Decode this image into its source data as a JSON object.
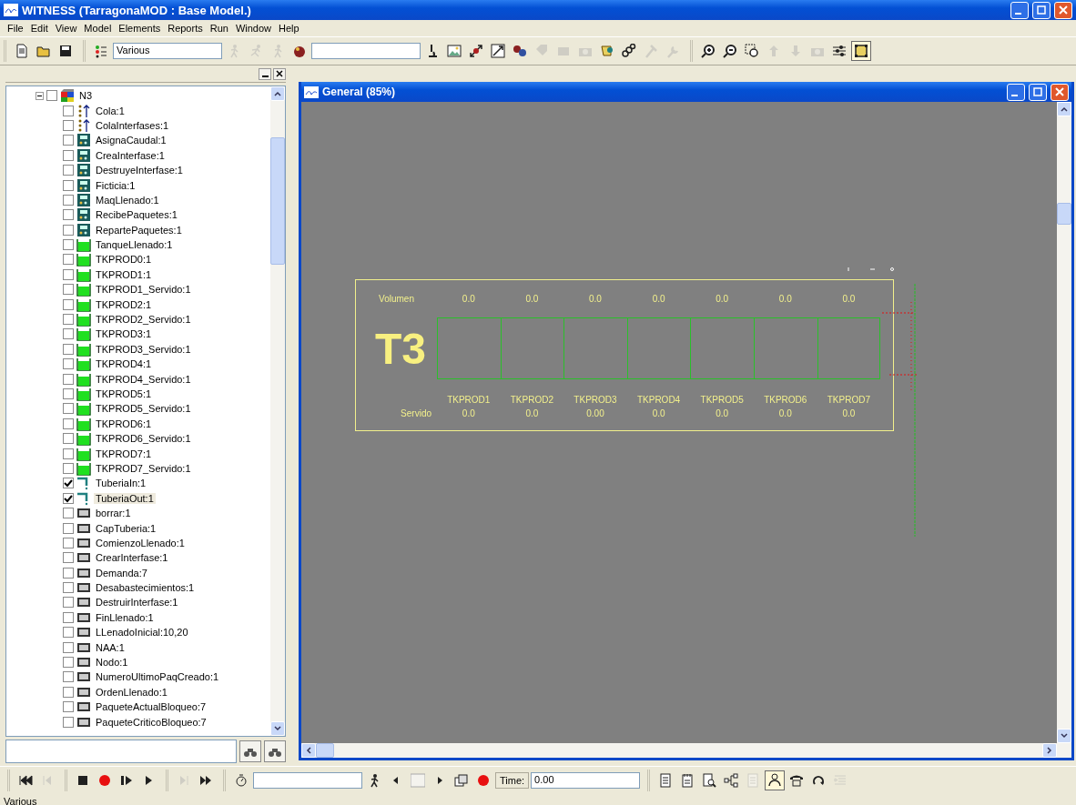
{
  "window": {
    "title": "WITNESS (TarragonaMOD : Base Model.)"
  },
  "menu": [
    "File",
    "Edit",
    "View",
    "Model",
    "Elements",
    "Reports",
    "Run",
    "Window",
    "Help"
  ],
  "toolbar_groups": [
    [
      {
        "kind": "new",
        "disabled": false,
        "pressed": false
      },
      {
        "kind": "open",
        "disabled": false,
        "pressed": false
      },
      {
        "kind": "save",
        "disabled": false,
        "pressed": false
      }
    ],
    [
      {
        "kind": "list",
        "disabled": false,
        "pressed": false
      },
      {
        "kind": "field",
        "value": "Various"
      },
      {
        "kind": "walker",
        "disabled": true,
        "pressed": false
      },
      {
        "kind": "runner",
        "disabled": true,
        "pressed": false
      },
      {
        "kind": "walker",
        "disabled": true,
        "pressed": false
      },
      {
        "kind": "ball",
        "disabled": false,
        "pressed": false
      },
      {
        "kind": "field"
      },
      {
        "kind": "microscope",
        "disabled": false,
        "pressed": false
      },
      {
        "kind": "picture",
        "disabled": false,
        "pressed": false
      },
      {
        "kind": "arrows",
        "disabled": false,
        "pressed": false
      },
      {
        "kind": "resize",
        "disabled": false,
        "pressed": false
      },
      {
        "kind": "balls",
        "disabled": false,
        "pressed": false
      },
      {
        "kind": "tag",
        "disabled": true,
        "pressed": false
      },
      {
        "kind": "box",
        "disabled": true,
        "pressed": false
      },
      {
        "kind": "camera",
        "disabled": true,
        "pressed": false
      },
      {
        "kind": "scroll",
        "disabled": false,
        "pressed": false
      },
      {
        "kind": "links",
        "disabled": false,
        "pressed": false
      },
      {
        "kind": "hammer",
        "disabled": true,
        "pressed": false
      },
      {
        "kind": "wrench",
        "disabled": true,
        "pressed": false
      }
    ],
    [
      {
        "kind": "zoomin",
        "disabled": false,
        "pressed": false
      },
      {
        "kind": "zoomout",
        "disabled": false,
        "pressed": false
      },
      {
        "kind": "zoomfit",
        "disabled": false,
        "pressed": false
      },
      {
        "kind": "up",
        "disabled": true,
        "pressed": false
      },
      {
        "kind": "down",
        "disabled": true,
        "pressed": false
      },
      {
        "kind": "camera",
        "disabled": true,
        "pressed": false
      },
      {
        "kind": "sliders",
        "disabled": false,
        "pressed": false
      },
      {
        "kind": "frame",
        "disabled": false,
        "pressed": true
      }
    ]
  ],
  "tree": {
    "label": "N3",
    "kind": "module",
    "checked": false,
    "expanded": true,
    "children": [
      {
        "label": "Cola:1",
        "kind": "queue",
        "checked": false
      },
      {
        "label": "ColaInterfases:1",
        "kind": "queue",
        "checked": false
      },
      {
        "label": "AsignaCaudal:1",
        "kind": "machine",
        "checked": false
      },
      {
        "label": "CreaInterfase:1",
        "kind": "machine",
        "checked": false
      },
      {
        "label": "DestruyeInterfase:1",
        "kind": "machine",
        "checked": false
      },
      {
        "label": "Ficticia:1",
        "kind": "machine",
        "checked": false
      },
      {
        "label": "MaqLlenado:1",
        "kind": "machine",
        "checked": false
      },
      {
        "label": "RecibePaquetes:1",
        "kind": "machine",
        "checked": false
      },
      {
        "label": "RepartePaquetes:1",
        "kind": "machine",
        "checked": false
      },
      {
        "label": "TanqueLlenado:1",
        "kind": "tank",
        "checked": false
      },
      {
        "label": "TKPROD0:1",
        "kind": "tank",
        "checked": false
      },
      {
        "label": "TKPROD1:1",
        "kind": "tank",
        "checked": false
      },
      {
        "label": "TKPROD1_Servido:1",
        "kind": "tank",
        "checked": false
      },
      {
        "label": "TKPROD2:1",
        "kind": "tank",
        "checked": false
      },
      {
        "label": "TKPROD2_Servido:1",
        "kind": "tank",
        "checked": false
      },
      {
        "label": "TKPROD3:1",
        "kind": "tank",
        "checked": false
      },
      {
        "label": "TKPROD3_Servido:1",
        "kind": "tank",
        "checked": false
      },
      {
        "label": "TKPROD4:1",
        "kind": "tank",
        "checked": false
      },
      {
        "label": "TKPROD4_Servido:1",
        "kind": "tank",
        "checked": false
      },
      {
        "label": "TKPROD5:1",
        "kind": "tank",
        "checked": false
      },
      {
        "label": "TKPROD5_Servido:1",
        "kind": "tank",
        "checked": false
      },
      {
        "label": "TKPROD6:1",
        "kind": "tank",
        "checked": false
      },
      {
        "label": "TKPROD6_Servido:1",
        "kind": "tank",
        "checked": false
      },
      {
        "label": "TKPROD7:1",
        "kind": "tank",
        "checked": false
      },
      {
        "label": "TKPROD7_Servido:1",
        "kind": "tank",
        "checked": false
      },
      {
        "label": "TuberiaIn:1",
        "kind": "pipe",
        "checked": true
      },
      {
        "label": "TuberiaOut:1",
        "kind": "pipe",
        "checked": true,
        "selected": true
      },
      {
        "label": "borrar:1",
        "kind": "variable",
        "checked": false
      },
      {
        "label": "CapTuberia:1",
        "kind": "variable",
        "checked": false
      },
      {
        "label": "ComienzoLlenado:1",
        "kind": "variable",
        "checked": false
      },
      {
        "label": "CrearInterfase:1",
        "kind": "variable",
        "checked": false
      },
      {
        "label": "Demanda:7",
        "kind": "variable",
        "checked": false
      },
      {
        "label": "Desabastecimientos:1",
        "kind": "variable",
        "checked": false
      },
      {
        "label": "DestruirInterfase:1",
        "kind": "variable",
        "checked": false
      },
      {
        "label": "FinLlenado:1",
        "kind": "variable",
        "checked": false
      },
      {
        "label": "LLenadoInicial:10,20",
        "kind": "variable",
        "checked": false
      },
      {
        "label": "NAA:1",
        "kind": "variable",
        "checked": false
      },
      {
        "label": "Nodo:1",
        "kind": "variable",
        "checked": false
      },
      {
        "label": "NumeroUltimoPaqCreado:1",
        "kind": "variable",
        "checked": false
      },
      {
        "label": "OrdenLlenado:1",
        "kind": "variable",
        "checked": false
      },
      {
        "label": "PaqueteActualBloqueo:7",
        "kind": "variable",
        "checked": false
      },
      {
        "label": "PaqueteCriticoBloqueo:7",
        "kind": "variable",
        "checked": false
      }
    ]
  },
  "child_window": {
    "title": "General (85%)"
  },
  "diagram": {
    "title": "T3",
    "volume_label": "Volumen",
    "served_label": "Servido",
    "tanks": [
      {
        "name": "TKPROD1",
        "volume": "0.0",
        "served": "0.0"
      },
      {
        "name": "TKPROD2",
        "volume": "0.0",
        "served": "0.0"
      },
      {
        "name": "TKPROD3",
        "volume": "0.0",
        "served": "0.00"
      },
      {
        "name": "TKPROD4",
        "volume": "0.0",
        "served": "0.0"
      },
      {
        "name": "TKPROD5",
        "volume": "0.0",
        "served": "0.0"
      },
      {
        "name": "TKPROD6",
        "volume": "0.0",
        "served": "0.0"
      },
      {
        "name": "TKPROD7",
        "volume": "0.0",
        "served": "0.0"
      }
    ]
  },
  "bottom_toolbar_groups": [
    [
      {
        "kind": "rewind",
        "disabled": false,
        "pressed": false
      },
      {
        "kind": "stepback",
        "disabled": true,
        "pressed": false
      }
    ],
    [
      {
        "kind": "stop",
        "disabled": false,
        "pressed": false
      },
      {
        "kind": "record",
        "disabled": false,
        "pressed": false
      },
      {
        "kind": "step",
        "disabled": false,
        "pressed": false
      },
      {
        "kind": "play",
        "disabled": false,
        "pressed": false
      }
    ],
    [
      {
        "kind": "end",
        "disabled": true,
        "pressed": false
      },
      {
        "kind": "ff",
        "disabled": false,
        "pressed": false
      }
    ],
    [
      {
        "kind": "timer",
        "disabled": false,
        "pressed": false
      },
      {
        "kind": "field"
      },
      {
        "kind": "walker",
        "disabled": false,
        "pressed": false
      },
      {
        "kind": "left",
        "disabled": false,
        "pressed": false
      },
      {
        "kind": "track",
        "disabled": false,
        "pressed": false
      },
      {
        "kind": "right",
        "disabled": false,
        "pressed": false
      },
      {
        "kind": "film",
        "disabled": false,
        "pressed": false
      },
      {
        "kind": "record",
        "disabled": false,
        "pressed": false
      },
      {
        "kind": "label",
        "text": "Time:"
      },
      {
        "kind": "field",
        "value": "0.00"
      }
    ],
    [
      {
        "kind": "doc",
        "disabled": false,
        "pressed": false
      },
      {
        "kind": "notepad",
        "disabled": false,
        "pressed": false
      },
      {
        "kind": "preview",
        "disabled": false,
        "pressed": false
      },
      {
        "kind": "tree",
        "disabled": false,
        "pressed": false
      },
      {
        "kind": "doc",
        "disabled": true,
        "pressed": false
      },
      {
        "kind": "person",
        "disabled": false,
        "pressed": true
      },
      {
        "kind": "phone",
        "disabled": false,
        "pressed": false
      },
      {
        "kind": "loop",
        "disabled": false,
        "pressed": false
      },
      {
        "kind": "indent",
        "disabled": true,
        "pressed": false
      }
    ]
  ],
  "status_bar": "Various"
}
